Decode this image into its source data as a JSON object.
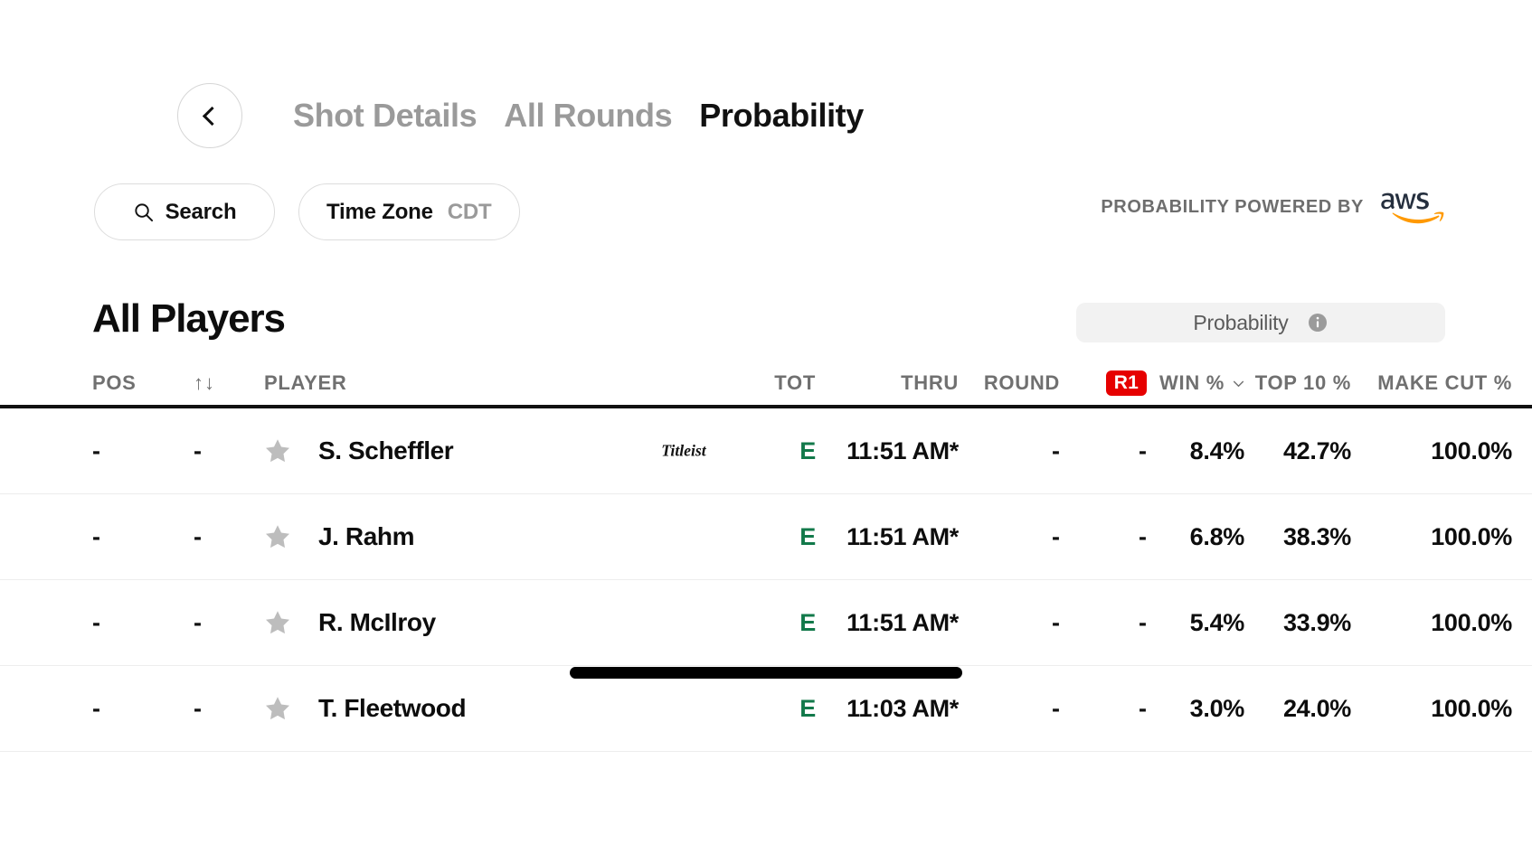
{
  "nav": {
    "back_icon": "chevron-left-icon",
    "tabs": [
      {
        "label": "Shot Details",
        "active": false
      },
      {
        "label": "All Rounds",
        "active": false
      },
      {
        "label": "Probability",
        "active": true
      }
    ]
  },
  "controls": {
    "search": {
      "label": "Search",
      "icon": "search-icon"
    },
    "timezone": {
      "label": "Time Zone",
      "value": "CDT"
    }
  },
  "attribution": {
    "text": "PROBABILITY POWERED BY",
    "logo": "aws-logo",
    "logo_color": "#252f3e",
    "logo_accent": "#ff9900"
  },
  "section": {
    "title": "All Players",
    "toggle": {
      "label": "Probability",
      "icon": "info-icon",
      "background": "#f2f2f2"
    }
  },
  "table": {
    "columns": [
      {
        "key": "pos",
        "label": "POS"
      },
      {
        "key": "mov",
        "label": "↑↓"
      },
      {
        "key": "player",
        "label": "PLAYER"
      },
      {
        "key": "brand",
        "label": ""
      },
      {
        "key": "tot",
        "label": "TOT"
      },
      {
        "key": "thru",
        "label": "THRU"
      },
      {
        "key": "round",
        "label": "ROUND"
      },
      {
        "key": "r1",
        "label": "R1"
      },
      {
        "key": "win",
        "label": "WIN %"
      },
      {
        "key": "top10",
        "label": "TOP 10 %"
      },
      {
        "key": "cut",
        "label": "MAKE CUT %"
      }
    ],
    "r1_badge_color": "#e60000",
    "sorted_column": "WIN %",
    "rows": [
      {
        "pos": "-",
        "mov": "-",
        "star": "star-icon",
        "player": "S. Scheffler",
        "brand": "titleist-logo",
        "tot": "E",
        "thru": "11:51 AM*",
        "round": "-",
        "r1": "-",
        "win": "8.4%",
        "top10": "42.7%",
        "cut": "100.0%"
      },
      {
        "pos": "-",
        "mov": "-",
        "star": "star-icon",
        "player": "J. Rahm",
        "brand": "",
        "tot": "E",
        "thru": "11:51 AM*",
        "round": "-",
        "r1": "-",
        "win": "6.8%",
        "top10": "38.3%",
        "cut": "100.0%"
      },
      {
        "pos": "-",
        "mov": "-",
        "star": "star-icon",
        "player": "R. McIlroy",
        "brand": "",
        "tot": "E",
        "thru": "11:51 AM*",
        "round": "-",
        "r1": "-",
        "win": "5.4%",
        "top10": "33.9%",
        "cut": "100.0%"
      },
      {
        "pos": "-",
        "mov": "-",
        "star": "star-icon",
        "player": "T. Fleetwood",
        "brand": "",
        "tot": "E",
        "thru": "11:03 AM*",
        "round": "-",
        "r1": "-",
        "win": "3.0%",
        "top10": "24.0%",
        "cut": "100.0%"
      }
    ]
  }
}
